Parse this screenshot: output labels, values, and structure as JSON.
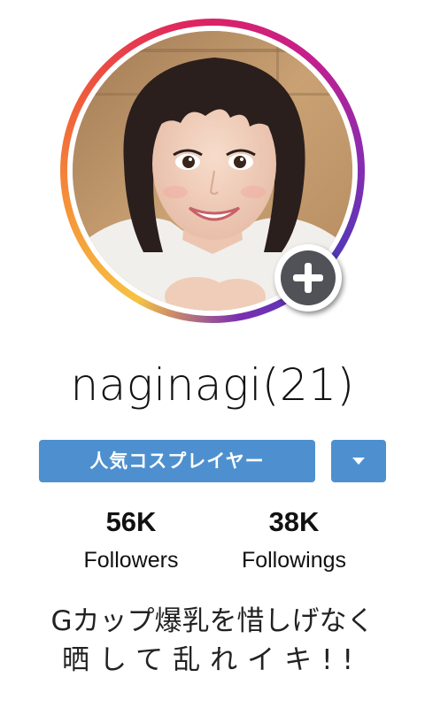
{
  "profile": {
    "username": "naginagi(21)",
    "avatar_icon": "profile-photo",
    "add_icon": "plus-icon"
  },
  "tag": {
    "label": "人気コスプレイヤー",
    "dropdown_icon": "caret-down-icon",
    "color": "#4e90cf"
  },
  "stats": {
    "followers": {
      "count": "56K",
      "label": "Followers"
    },
    "following": {
      "count": "38K",
      "label": "Followings"
    }
  },
  "bio": {
    "line1": "Gカップ爆乳を惜しげなく",
    "line2": "晒して乱れイキ!!"
  },
  "colors": {
    "ring_start": "#f6c242",
    "ring_mid": "#e0245e",
    "ring_end": "#4a3ab8",
    "add_button": "#505257"
  }
}
